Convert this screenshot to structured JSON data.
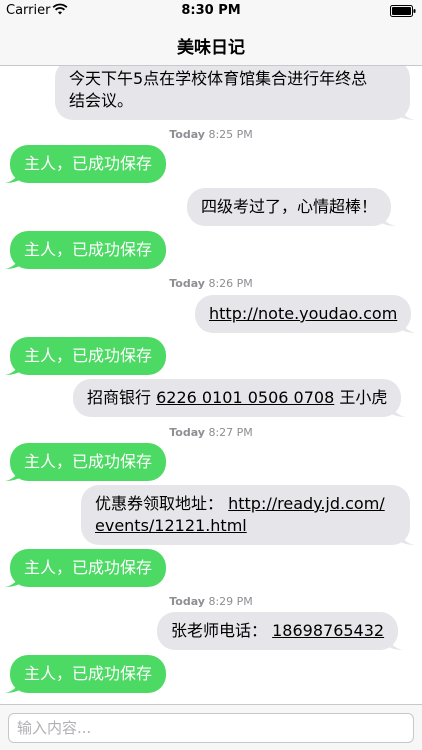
{
  "status_bar": {
    "carrier": "Carrier",
    "time": "8:30 PM",
    "wifi_icon": "wifi-icon",
    "battery_icon": "battery-icon"
  },
  "nav": {
    "title": "美味日记"
  },
  "colors": {
    "incoming": "#e5e5ea",
    "outgoing": "#4cd964",
    "timestamp": "#8e8e93"
  },
  "messages": {
    "m1": {
      "line1": "今天下午5点在学校体育馆集合进行年终总",
      "line2": "结会议。"
    },
    "t1": {
      "day": "Today",
      "time": "8:25 PM"
    },
    "r1": "主人，已成功保存",
    "m2": "四级考过了，心情超棒！",
    "r2": "主人，已成功保存",
    "t2": {
      "day": "Today",
      "time": "8:26 PM"
    },
    "m3": "http://note.youdao.com",
    "r3": "主人，已成功保存",
    "m4": {
      "prefix": "招商银行",
      "number": "6226 0101 0506 0708",
      "suffix": "王小虎"
    },
    "t3": {
      "day": "Today",
      "time": "8:27 PM"
    },
    "r4": "主人，已成功保存",
    "m5": {
      "prefix": "优惠券领取地址：",
      "link_line1": "http://ready.jd.com/",
      "link_line2": "events/12121.html"
    },
    "r5": "主人，已成功保存",
    "t4": {
      "day": "Today",
      "time": "8:29 PM"
    },
    "m6": {
      "prefix": "张老师电话：",
      "phone": "18698765432"
    },
    "r6": "主人，已成功保存"
  },
  "input": {
    "placeholder": "输入内容..."
  }
}
